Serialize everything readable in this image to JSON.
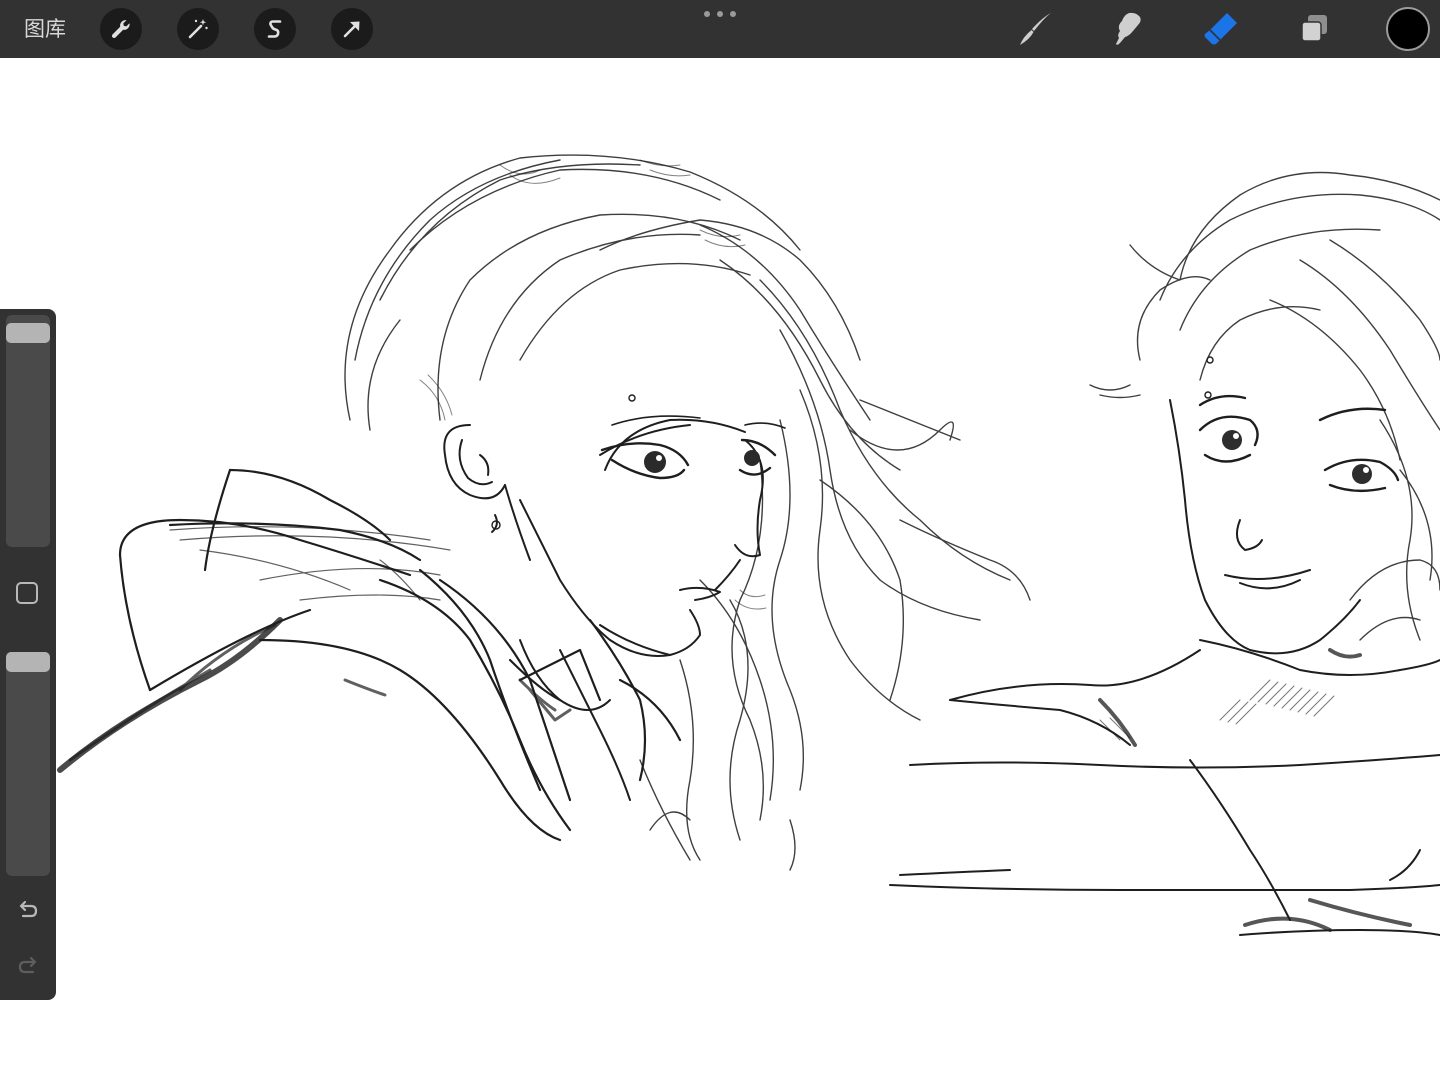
{
  "toolbar": {
    "gallery_label": "图库",
    "left_tools": [
      {
        "icon": "wrench-icon",
        "name": "actions"
      },
      {
        "icon": "magic-wand-icon",
        "name": "adjustments"
      },
      {
        "icon": "selection-s-icon",
        "name": "selection"
      },
      {
        "icon": "arrow-cursor-icon",
        "name": "transform"
      }
    ],
    "right_tools": [
      {
        "icon": "brush-icon",
        "name": "paint",
        "active": false
      },
      {
        "icon": "smudge-icon",
        "name": "smudge",
        "active": false
      },
      {
        "icon": "eraser-icon",
        "name": "erase",
        "active": true
      },
      {
        "icon": "layers-icon",
        "name": "layers",
        "active": false
      }
    ],
    "current_color": "#000000",
    "active_color": "#1b74e8"
  },
  "sidebar": {
    "brush_size_level": 0,
    "opacity_level": 0,
    "icons": [
      "modify-square-icon",
      "undo-icon",
      "redo-icon"
    ]
  },
  "canvas": {
    "background": "#ffffff",
    "content": "pencil sketch"
  }
}
